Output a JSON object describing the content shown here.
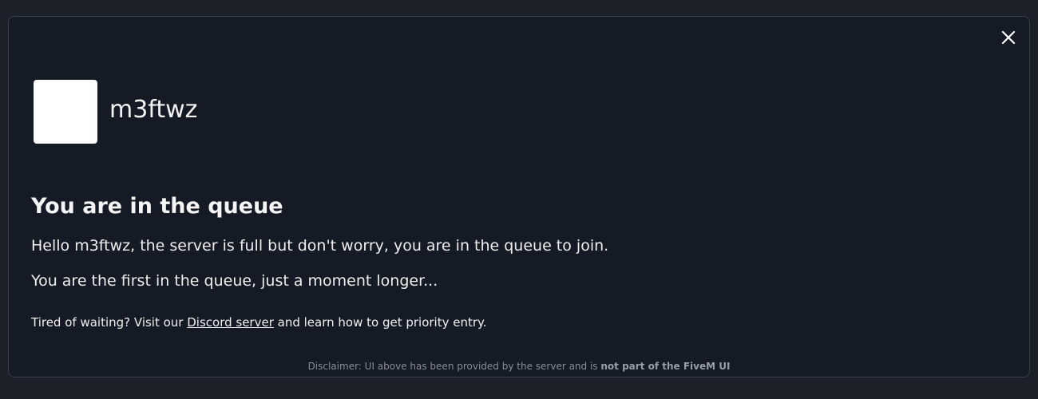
{
  "dialog": {
    "close_icon": "close-icon",
    "server": {
      "name": "m3ftwz",
      "logo_color": "#ffffff"
    },
    "title": "You are in the queue",
    "message_1": "Hello m3ftwz, the server is full but don't worry, you are in the queue to join.",
    "message_2": "You are the first in the queue, just a moment longer...",
    "tip": {
      "prefix": "Tired of waiting? Visit our ",
      "link_label": "Discord server",
      "suffix": " and learn how to get priority entry."
    },
    "disclaimer": {
      "prefix": "Disclaimer: UI above has been provided by the server and is ",
      "emphasis": "not part of the FiveM UI"
    }
  },
  "colors": {
    "dialog_bg": "#161a24",
    "border": "#3b3f4a",
    "text": "#f5f5f5",
    "muted": "#8a8d94"
  }
}
